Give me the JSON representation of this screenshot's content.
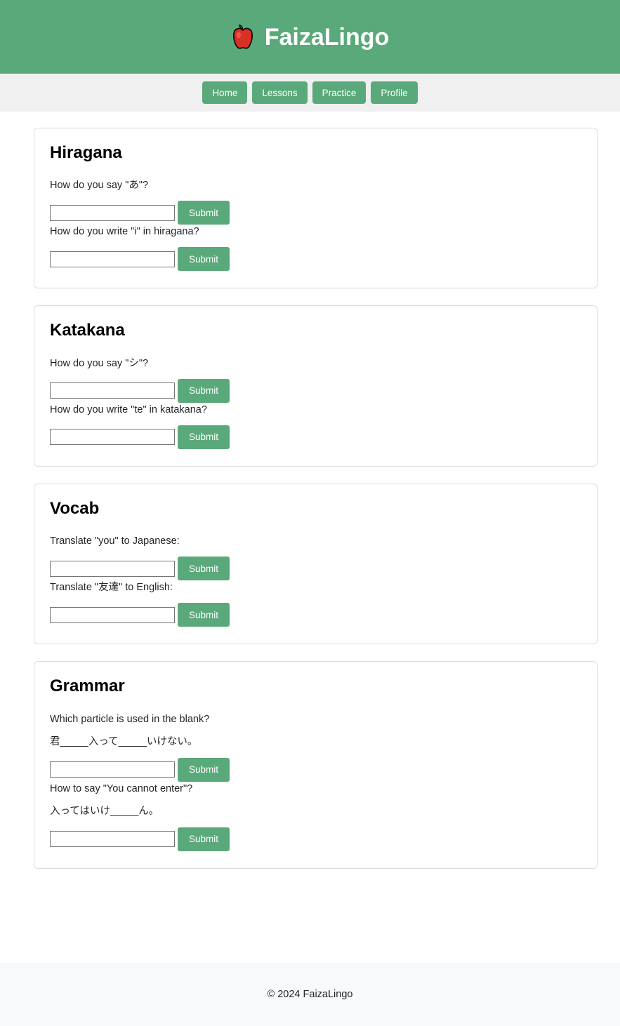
{
  "header": {
    "logo_icon": "apple-icon",
    "title": "FaizaLingo",
    "background_color": "#5aa97a"
  },
  "nav": {
    "background_color": "#f0f0f0",
    "items": [
      {
        "label": "Home"
      },
      {
        "label": "Lessons"
      },
      {
        "label": "Practice"
      },
      {
        "label": "Profile"
      }
    ]
  },
  "main": {
    "sections": [
      {
        "title": "Hiragana",
        "questions": [
          {
            "prompt": "How do you say \"あ\"?",
            "sentence": "",
            "input_value": "",
            "input_placeholder": "",
            "submit_label": "Submit"
          },
          {
            "prompt": "How do you write \"i\" in hiragana?",
            "sentence": "",
            "input_value": "",
            "input_placeholder": "",
            "submit_label": "Submit"
          }
        ]
      },
      {
        "title": "Katakana",
        "questions": [
          {
            "prompt": "How do you say \"シ\"?",
            "sentence": "",
            "input_value": "",
            "input_placeholder": "",
            "submit_label": "Submit"
          },
          {
            "prompt": "How do you write \"te\" in katakana?",
            "sentence": "",
            "input_value": "",
            "input_placeholder": "",
            "submit_label": "Submit"
          }
        ]
      },
      {
        "title": "Vocab",
        "questions": [
          {
            "prompt": "Translate \"you\" to Japanese:",
            "sentence": "",
            "input_value": "",
            "input_placeholder": "",
            "submit_label": "Submit"
          },
          {
            "prompt": "Translate \"友達\" to English:",
            "sentence": "",
            "input_value": "",
            "input_placeholder": "",
            "submit_label": "Submit"
          }
        ]
      },
      {
        "title": "Grammar",
        "questions": [
          {
            "prompt": "Which particle is used in the blank?",
            "sentence": "君_____入って_____いけない。",
            "input_value": "",
            "input_placeholder": "",
            "submit_label": "Submit"
          },
          {
            "prompt": "How to say \"You cannot enter\"?",
            "sentence": "入ってはいけ_____ん。",
            "input_value": "",
            "input_placeholder": "",
            "submit_label": "Submit"
          }
        ]
      }
    ]
  },
  "footer": {
    "text": "© 2024 FaizaLingo"
  },
  "theme": {
    "accent": "#5aa97a",
    "nav_bg": "#f0f0f0",
    "footer_bg": "#f7f9fa",
    "card_border": "#dcdcdc"
  }
}
